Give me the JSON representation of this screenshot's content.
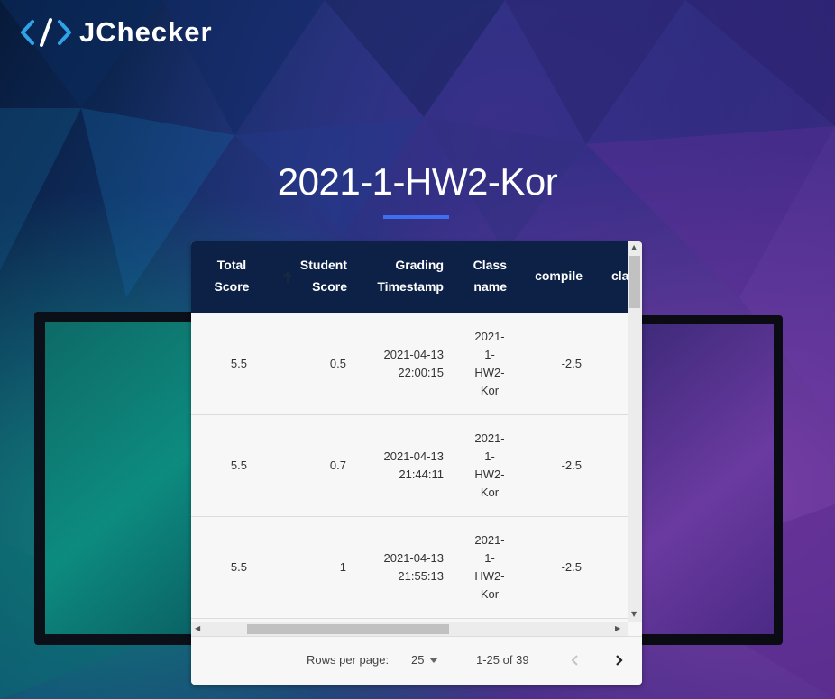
{
  "app": {
    "name": "JChecker"
  },
  "page": {
    "title": "2021-1-HW2-Kor"
  },
  "table": {
    "columns": {
      "total_score": [
        "Total",
        "Score"
      ],
      "student_score": [
        "Student",
        "Score"
      ],
      "grading_timestamp": [
        "Grading",
        "Timestamp"
      ],
      "class_name": [
        "Class",
        "name"
      ],
      "compile": "compile",
      "next": "cla"
    },
    "rows": [
      {
        "total_score": "5.5",
        "student_score": "0.5",
        "ts_date": "2021-04-13",
        "ts_time": "22:00:15",
        "class_name": [
          "2021-",
          "1-",
          "HW2-",
          "Kor"
        ],
        "compile": "-2.5"
      },
      {
        "total_score": "5.5",
        "student_score": "0.7",
        "ts_date": "2021-04-13",
        "ts_time": "21:44:11",
        "class_name": [
          "2021-",
          "1-",
          "HW2-",
          "Kor"
        ],
        "compile": "-2.5"
      },
      {
        "total_score": "5.5",
        "student_score": "1",
        "ts_date": "2021-04-13",
        "ts_time": "21:55:13",
        "class_name": [
          "2021-",
          "1-",
          "HW2-",
          "Kor"
        ],
        "compile": "-2.5"
      }
    ]
  },
  "pagination": {
    "rows_per_page_label": "Rows per page:",
    "rows_per_page_value": "25",
    "range_text": "1-25 of 39"
  },
  "colors": {
    "header_bg": "#0d2147",
    "accent": "#3f6ff0"
  }
}
